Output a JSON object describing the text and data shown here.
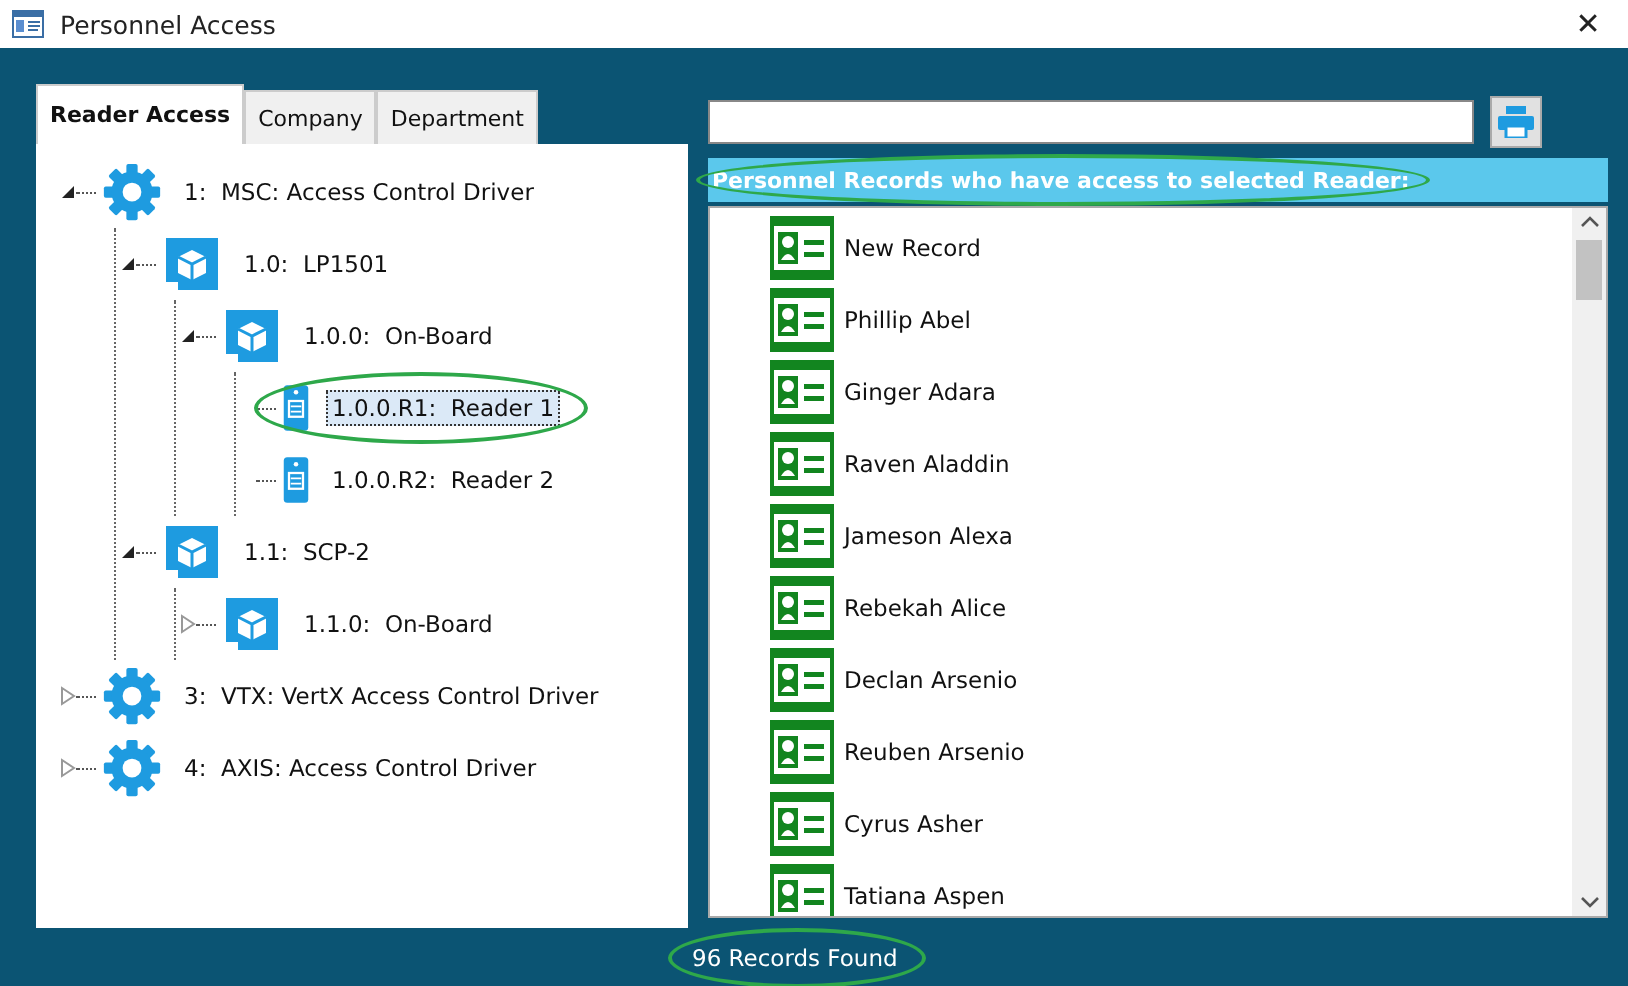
{
  "window": {
    "title": "Personnel Access",
    "close": "✕"
  },
  "tabs": [
    {
      "label": "Reader Access",
      "selected": true
    },
    {
      "label": "Company",
      "selected": false
    },
    {
      "label": "Department",
      "selected": false
    }
  ],
  "tree": [
    {
      "kind": "driver",
      "label": "1:  MSC: Access Control Driver",
      "expanded": true,
      "selected": false,
      "circled": false,
      "children": [
        {
          "kind": "board",
          "label": "1.0:  LP1501",
          "expanded": true,
          "selected": false,
          "circled": false,
          "children": [
            {
              "kind": "board",
              "label": "1.0.0:  On-Board",
              "expanded": true,
              "selected": false,
              "circled": false,
              "children": [
                {
                  "kind": "reader",
                  "label": "1.0.0.R1:  Reader 1",
                  "selected": true,
                  "circled": true
                },
                {
                  "kind": "reader",
                  "label": "1.0.0.R2:  Reader 2",
                  "selected": false,
                  "circled": false
                }
              ]
            }
          ]
        },
        {
          "kind": "board",
          "label": "1.1:  SCP-2",
          "expanded": true,
          "selected": false,
          "circled": false,
          "children": [
            {
              "kind": "board",
              "label": "1.1.0:  On-Board",
              "expanded": false,
              "selected": false,
              "circled": false
            }
          ]
        }
      ]
    },
    {
      "kind": "driver",
      "label": "3:  VTX: VertX Access Control Driver",
      "expanded": false,
      "selected": false,
      "circled": false
    },
    {
      "kind": "driver",
      "label": "4:  AXIS: Access Control Driver",
      "expanded": false,
      "selected": false,
      "circled": false
    }
  ],
  "records": {
    "header": "Personnel Records who have access to selected Reader:",
    "header_circled": true,
    "items": [
      "New Record",
      "Phillip Abel",
      "Ginger Adara",
      "Raven Aladdin",
      "Jameson Alexa",
      "Rebekah Alice",
      "Declan Arsenio",
      "Reuben Arsenio",
      "Cyrus Asher",
      "Tatiana Aspen"
    ]
  },
  "status": {
    "text": "96 Records Found",
    "circled": true
  }
}
